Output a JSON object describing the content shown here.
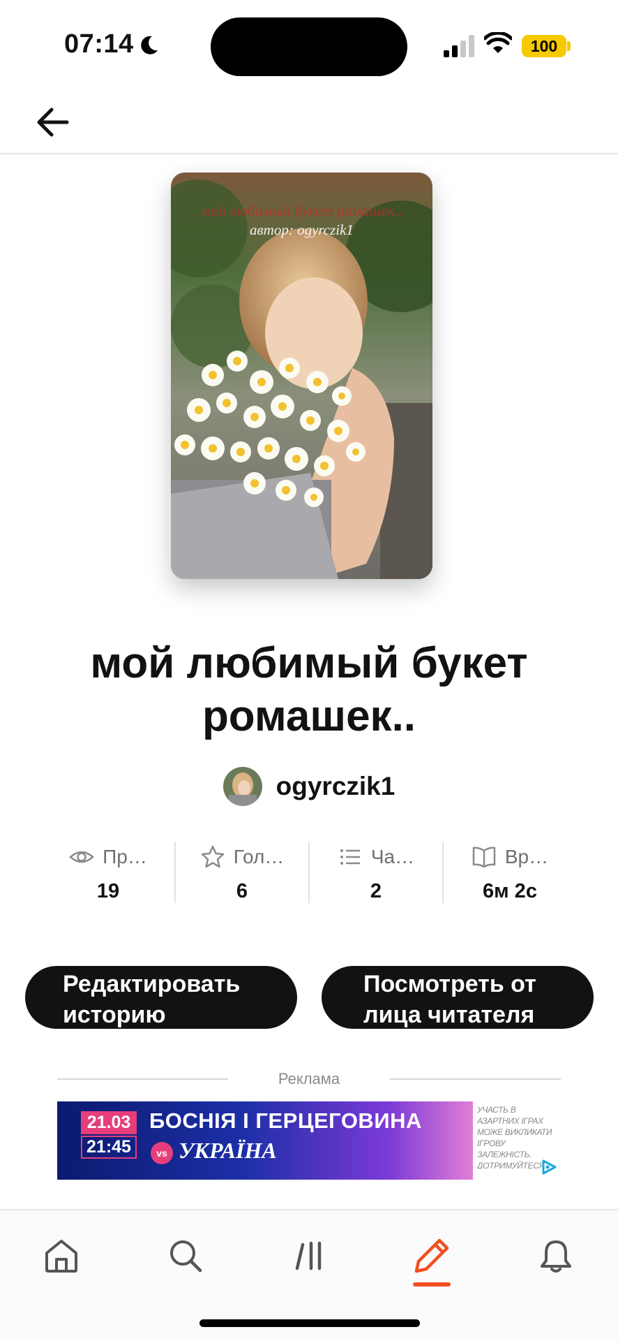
{
  "status_bar": {
    "time": "07:14",
    "battery": "100",
    "icons": [
      "moon-icon",
      "signal-icon",
      "wifi-icon",
      "battery-icon"
    ]
  },
  "nav": {
    "back_icon": "arrow-left-icon"
  },
  "cover": {
    "title_text": "мой любимый букет ромашек..",
    "author_text": "автор: ogyrczik1"
  },
  "story": {
    "title": "мой любимый букет ромашек..",
    "author": "ogyrczik1"
  },
  "stats": [
    {
      "icon": "eye-icon",
      "label": "Пр…",
      "value": "19"
    },
    {
      "icon": "star-icon",
      "label": "Гол…",
      "value": "6"
    },
    {
      "icon": "list-icon",
      "label": "Ча…",
      "value": "2"
    },
    {
      "icon": "book-open-icon",
      "label": "Вр…",
      "value": "6м 2с"
    }
  ],
  "actions": {
    "edit_label": "Редактировать историю",
    "view_label": "Посмотреть от лица читателя"
  },
  "ad": {
    "label": "Реклама",
    "date": "21.03",
    "time": "21:45",
    "headline": "БОСНІЯ І ГЕРЦЕГОВИНА",
    "vs": "vs",
    "team2": "УКРАЇНА",
    "side_text": "УЧАСТЬ В АЗАРТНИХ ІГРАХ МОЖЕ ВИКЛИКАТИ ІГРОВУ ЗАЛЕЖНІСТЬ. ДОТРИМУЙТЕСЯ ПРАВИЛ ГРИ"
  },
  "tab_bar": {
    "tabs": [
      "home-icon",
      "search-icon",
      "library-icon",
      "pencil-icon",
      "bell-icon"
    ],
    "active_tab": "pencil-icon",
    "accent_color": "#f24e1e"
  }
}
